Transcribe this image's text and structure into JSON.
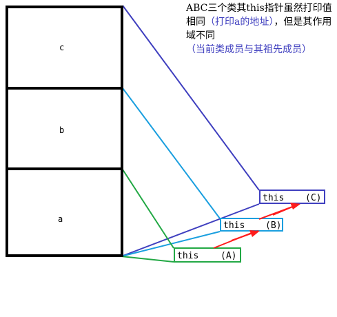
{
  "memory": {
    "cells": [
      {
        "label": "c"
      },
      {
        "label": "b"
      },
      {
        "label": "a"
      }
    ]
  },
  "pointers": [
    {
      "text": "this",
      "suffix": "(C)",
      "color": "#3f3fbf"
    },
    {
      "text": "this",
      "suffix": "(B)",
      "color": "#1a9fdf"
    },
    {
      "text": "this",
      "suffix": "(A)",
      "color": "#22a844"
    }
  ],
  "arrow_color": "#ff1c1c",
  "note": {
    "part1": "ABC三个类其this指针虽然打印值相同",
    "part2": "（打印a的地址）",
    "part3": "，但是其作用域不同",
    "part4": "（当前类成员与其祖先成员）",
    "highlight_color": "#3f3fbf"
  }
}
